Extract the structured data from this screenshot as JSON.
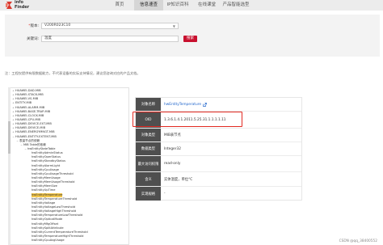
{
  "brand": {
    "line1": "info",
    "line2": "Finder",
    "color": "#d9362b"
  },
  "nav": {
    "items": [
      {
        "label": "首页",
        "active": false
      },
      {
        "label": "信息速查",
        "active": true
      },
      {
        "label": "IP知识百科",
        "active": false
      },
      {
        "label": "在线课堂",
        "active": false
      },
      {
        "label": "产品智能选型",
        "active": false
      }
    ]
  },
  "search": {
    "version_label": "版本:",
    "version_required": "*",
    "version_value": "V200R023C10",
    "keyword_label": "关键词:",
    "keyword_value": "温度",
    "button_label": "搜索",
    "button_color": "#c8102e"
  },
  "note": "注：工程仅提供有限数据能力，不代表设备的实际支持情况，建议您咨询对应的产品文档。",
  "tree": {
    "items": [
      {
        "label": "HUAWEI-DAD-MIB",
        "indent": 0,
        "toggle": "+"
      },
      {
        "label": "HUAWEI-STACK-MIB",
        "indent": 0,
        "toggle": "+"
      },
      {
        "label": "HUAWEI-VS-MIB",
        "indent": 0,
        "toggle": "+"
      },
      {
        "label": "ENTITY-MIB",
        "indent": 0,
        "toggle": "+"
      },
      {
        "label": "HUAWEI-ALARM-MIB",
        "indent": 0,
        "toggle": "+"
      },
      {
        "label": "HUAWEI-BASE-TRAP-MIB",
        "indent": 0,
        "toggle": "+"
      },
      {
        "label": "HUAWEI-CLOCK-MIB",
        "indent": 0,
        "toggle": "+"
      },
      {
        "label": "HUAWEI-CPU-MIB",
        "indent": 0,
        "toggle": "+"
      },
      {
        "label": "HUAWEI-DEVICE-EXT-MIB",
        "indent": 0,
        "toggle": "+"
      },
      {
        "label": "HUAWEI-DEVICE-MIB",
        "indent": 0,
        "toggle": "+"
      },
      {
        "label": "HUAWEI-ENERGYMNGT-MIB",
        "indent": 0,
        "toggle": "+"
      },
      {
        "label": "HUAWEI-ENTITY-EXTENT-MIB",
        "indent": 0,
        "toggle": "−"
      },
      {
        "label": "表量节点的依赖",
        "indent": 1,
        "toggle": "−"
      },
      {
        "label": "MIB Table的依赖",
        "indent": 2,
        "toggle": "−"
      },
      {
        "label": "hwEntityStateTable",
        "indent": 3,
        "toggle": "−"
      },
      {
        "label": "hwEntityAdminStatus",
        "indent": 4,
        "toggle": ""
      },
      {
        "label": "hwEntityOperStatus",
        "indent": 4,
        "toggle": ""
      },
      {
        "label": "hwEntityStandbyStatus",
        "indent": 4,
        "toggle": ""
      },
      {
        "label": "hwEntityAlarmLight",
        "indent": 4,
        "toggle": ""
      },
      {
        "label": "hwEntityCpuUsage",
        "indent": 4,
        "toggle": ""
      },
      {
        "label": "hwEntityCpuUsageThreshold",
        "indent": 4,
        "toggle": ""
      },
      {
        "label": "hwEntityMemUsage",
        "indent": 4,
        "toggle": ""
      },
      {
        "label": "hwEntityMemUsageThreshold",
        "indent": 4,
        "toggle": ""
      },
      {
        "label": "hwEntityMemSize",
        "indent": 4,
        "toggle": ""
      },
      {
        "label": "hwEntityUpTime",
        "indent": 4,
        "toggle": ""
      },
      {
        "label": "hwEntityTemperature",
        "indent": 4,
        "toggle": "",
        "selected": true
      },
      {
        "label": "hwEntityTemperatureThreshold",
        "indent": 4,
        "toggle": ""
      },
      {
        "label": "hwEntityVoltage",
        "indent": 4,
        "toggle": ""
      },
      {
        "label": "hwEntityVoltageLowThreshold",
        "indent": 4,
        "toggle": ""
      },
      {
        "label": "hwEntityVoltageHighThreshold",
        "indent": 4,
        "toggle": ""
      },
      {
        "label": "hwEntityTemperatureLowThreshold",
        "indent": 4,
        "toggle": ""
      },
      {
        "label": "hwEntityOpticalMode",
        "indent": 4,
        "toggle": ""
      },
      {
        "label": "hwEntityMfgOffset",
        "indent": 4,
        "toggle": ""
      },
      {
        "label": "hwEntitySplitAttribute",
        "indent": 4,
        "toggle": ""
      },
      {
        "label": "hwEntityCurrentTemperatureThreshold",
        "indent": 4,
        "toggle": ""
      },
      {
        "label": "hwEntityTemperatureHighThreshold",
        "indent": 4,
        "toggle": ""
      },
      {
        "label": "hwEntityCpuAvgUsage",
        "indent": 4,
        "toggle": ""
      }
    ]
  },
  "detail": {
    "rows": [
      {
        "key": "对象名称",
        "value": "hwEntityTemperature",
        "icon": "external-link-icon",
        "link": true
      },
      {
        "key": "OID",
        "value": "1.3.6.1.4.1.2011.5.25.31.1.1.1.1.11",
        "link": false
      },
      {
        "key": "对象类型",
        "value": "MIB表节点",
        "link": false
      },
      {
        "key": "数据类型",
        "value": "Integer32",
        "link": false
      },
      {
        "key": "最大访问权限",
        "value": "read-only",
        "link": false
      },
      {
        "key": "含义",
        "value": "实体温度，单位°C",
        "link": false
      },
      {
        "key": "实现规格",
        "value": "-",
        "link": false
      }
    ],
    "highlight_color": "#e22a22",
    "key_bg": "#4f4f4f"
  },
  "watermark": "CSDN @qq_38400552"
}
